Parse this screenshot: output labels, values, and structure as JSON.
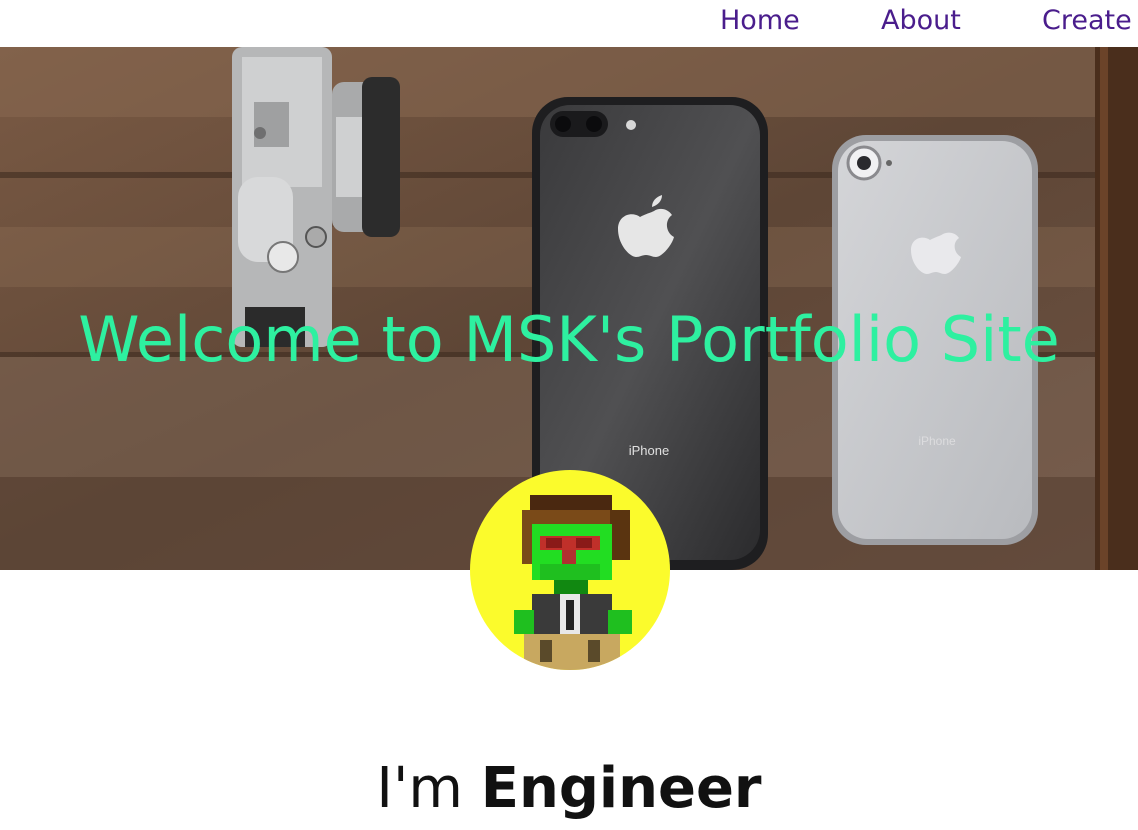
{
  "nav": {
    "home_label": "Home",
    "about_label": "About",
    "create_label": "Create"
  },
  "hero": {
    "title": "Welcome to MSK's Portfolio Site",
    "phone_brand_left": "iPhone",
    "phone_brand_right": "iPhone"
  },
  "intro": {
    "prefix": "I'm",
    "role": "Engineer"
  },
  "colors": {
    "nav_link": "#4a1d8c",
    "hero_title": "#2ef0a0",
    "avatar_bg": "#fbfb2c"
  }
}
